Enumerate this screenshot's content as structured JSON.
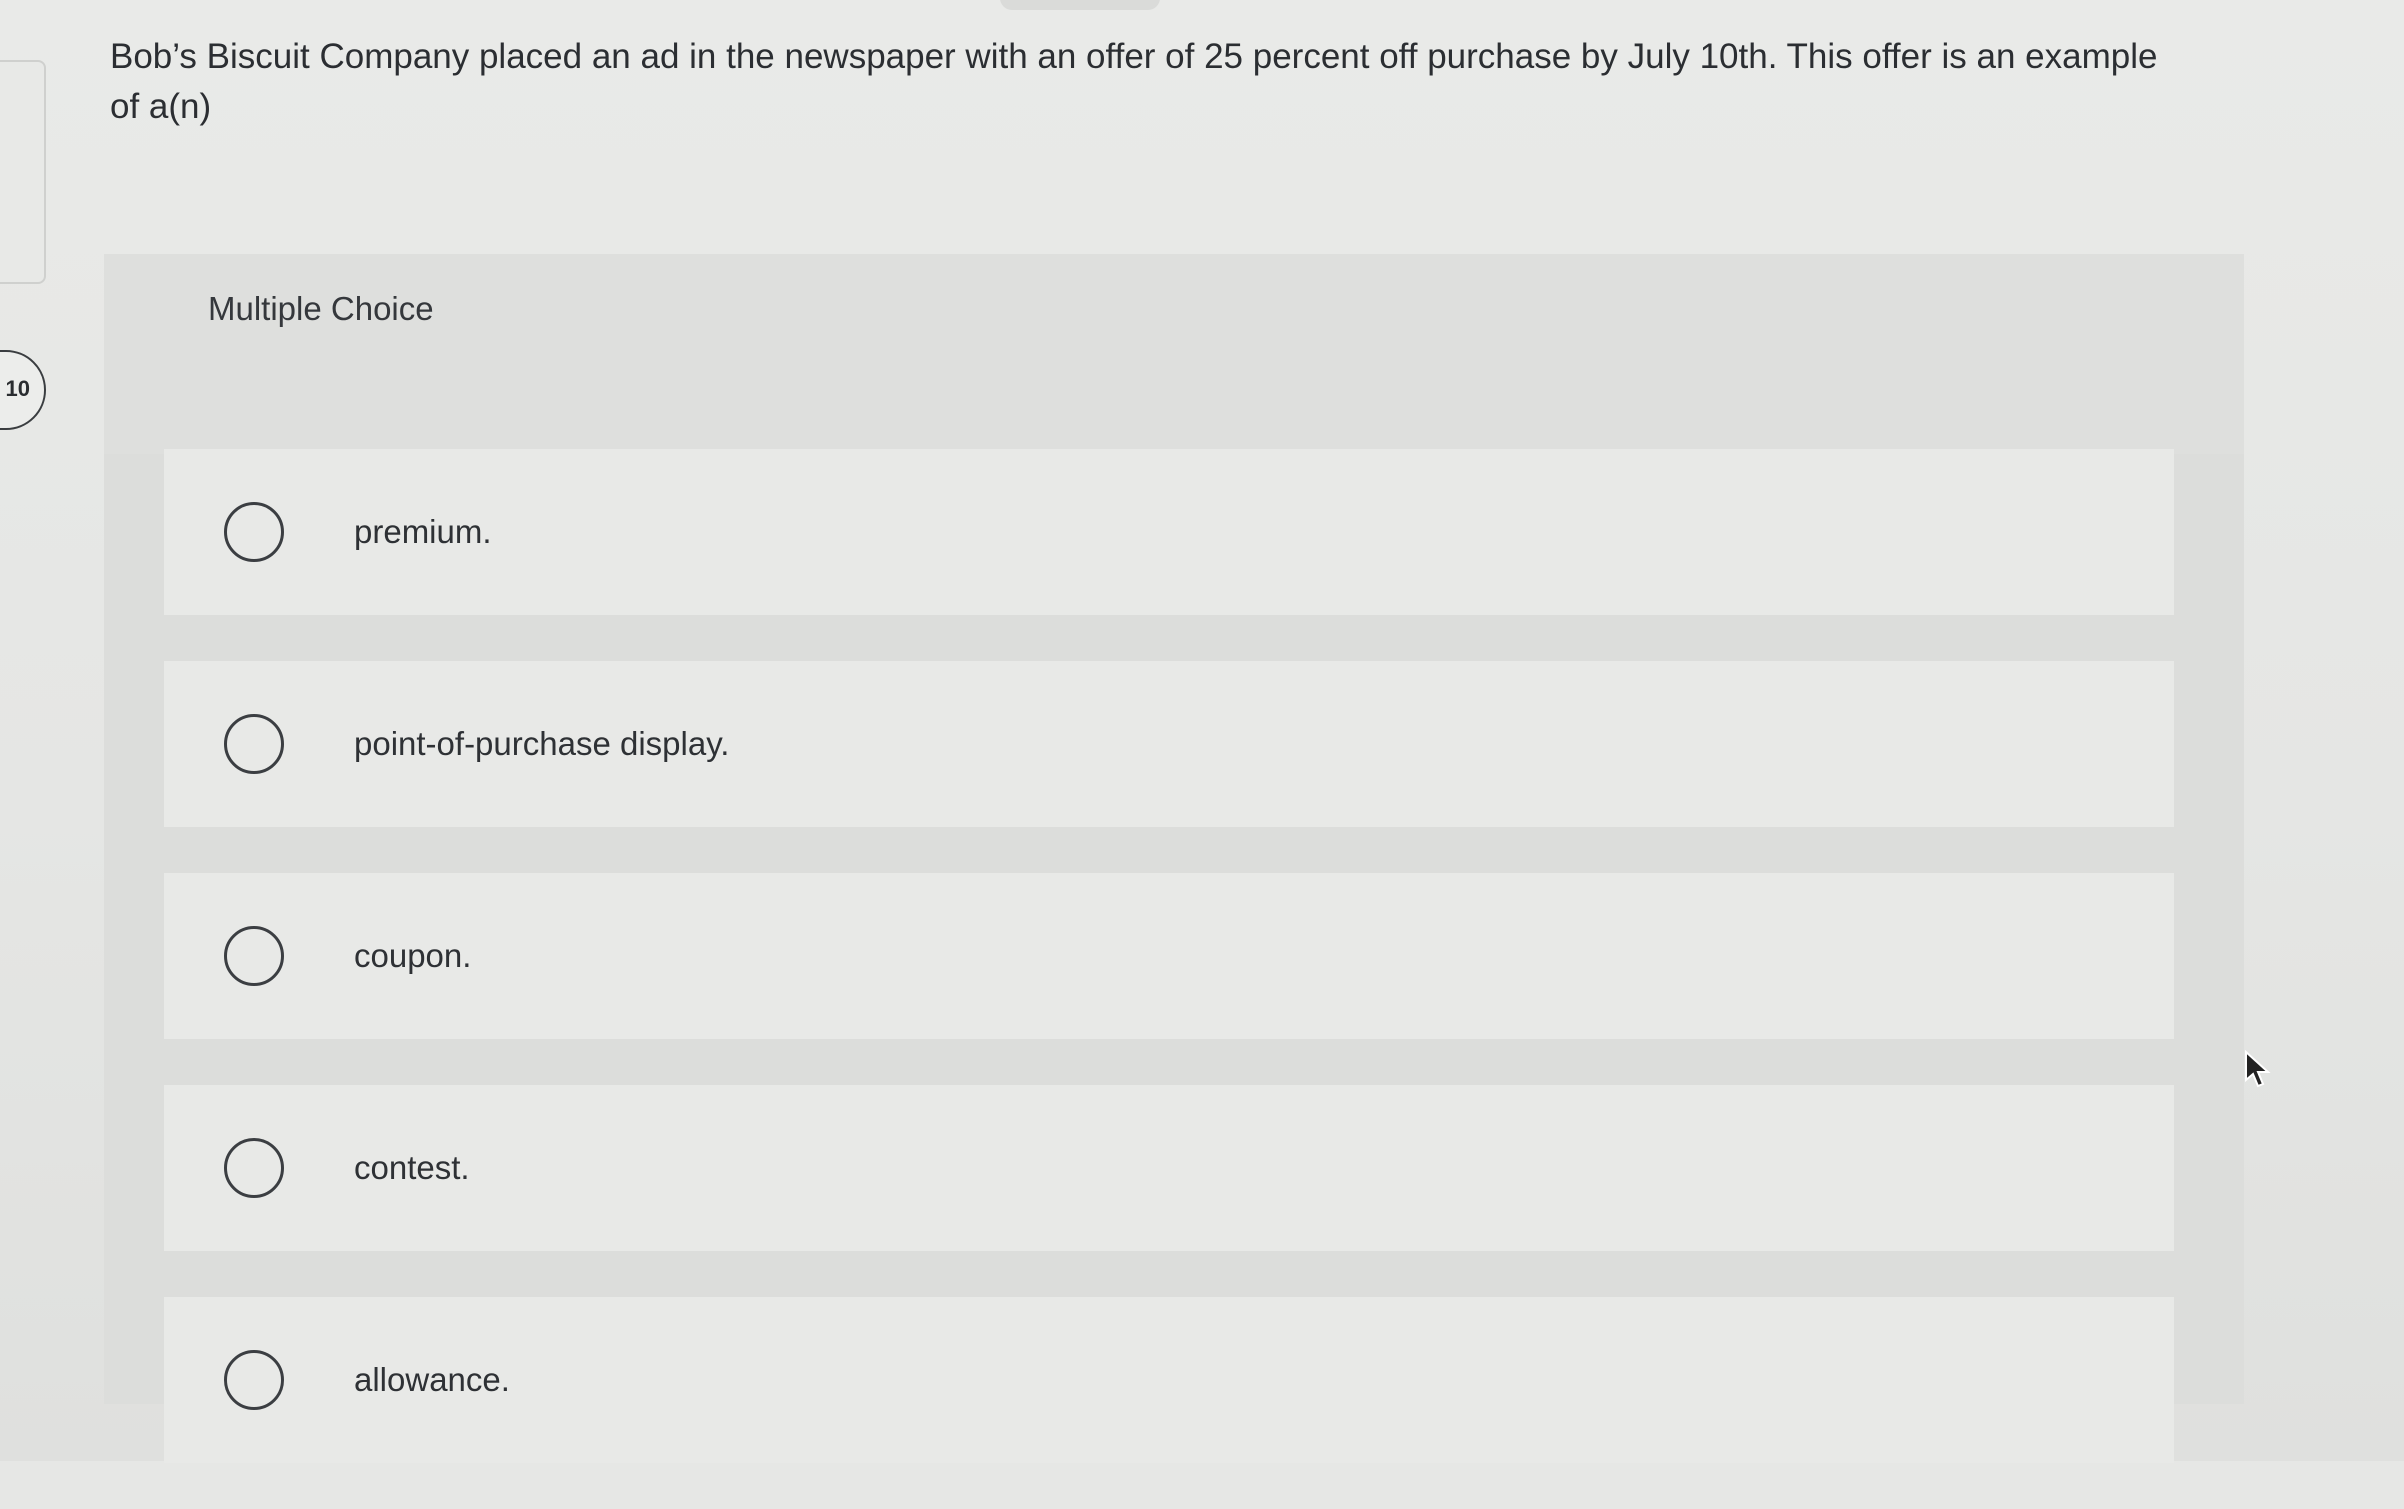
{
  "question": {
    "number": "10",
    "text": "Bob’s Biscuit Company placed an ad in the newspaper with an offer of 25 percent off purchase by July 10th. This offer is an example of a(n)"
  },
  "choice_block": {
    "type_label": "Multiple Choice",
    "options": [
      {
        "label": "premium.",
        "selected": false
      },
      {
        "label": "point-of-purchase display.",
        "selected": false
      },
      {
        "label": "coupon.",
        "selected": false
      },
      {
        "label": "contest.",
        "selected": false
      },
      {
        "label": "allowance.",
        "selected": false
      }
    ]
  },
  "icons": {
    "radio": "radio-button-unselected",
    "cursor": "mouse-pointer-arrow"
  }
}
